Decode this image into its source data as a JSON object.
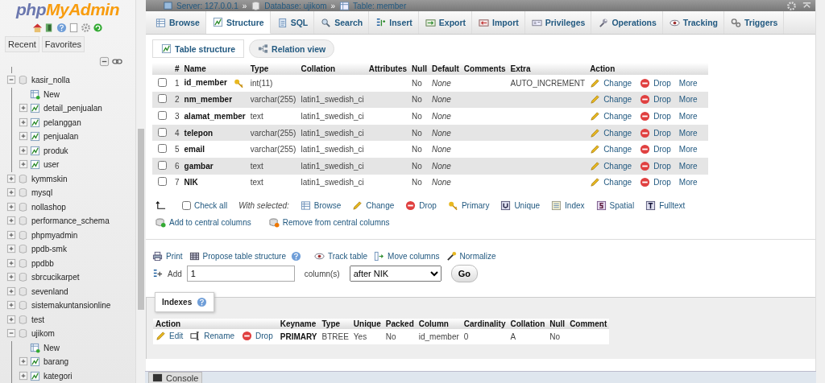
{
  "sidebar": {
    "logo_left": "php",
    "logo_right": "MyAdmin",
    "tabs": [
      {
        "label": "Recent"
      },
      {
        "label": "Favorites"
      }
    ],
    "tree": [
      {
        "kind": "db",
        "label": "kasir_nolla",
        "expanded": true,
        "children": [
          {
            "kind": "new",
            "label": "New"
          },
          {
            "kind": "table",
            "label": "detail_penjualan",
            "expanded": false
          },
          {
            "kind": "table",
            "label": "pelanggan",
            "expanded": false
          },
          {
            "kind": "table",
            "label": "penjualan",
            "expanded": false
          },
          {
            "kind": "table",
            "label": "produk",
            "expanded": false
          },
          {
            "kind": "table",
            "label": "user",
            "expanded": false
          }
        ]
      },
      {
        "kind": "db",
        "label": "kymmskin",
        "expanded": false
      },
      {
        "kind": "db",
        "label": "mysql",
        "expanded": false
      },
      {
        "kind": "db",
        "label": "nollashop",
        "expanded": false
      },
      {
        "kind": "db",
        "label": "performance_schema",
        "expanded": false
      },
      {
        "kind": "db",
        "label": "phpmyadmin",
        "expanded": false
      },
      {
        "kind": "db",
        "label": "ppdb-smk",
        "expanded": false
      },
      {
        "kind": "db",
        "label": "ppdbb",
        "expanded": false
      },
      {
        "kind": "db",
        "label": "sbrcucikarpet",
        "expanded": false
      },
      {
        "kind": "db",
        "label": "sevenland",
        "expanded": false
      },
      {
        "kind": "db",
        "label": "sistemakuntansionline",
        "expanded": false
      },
      {
        "kind": "db",
        "label": "test",
        "expanded": false
      },
      {
        "kind": "db",
        "label": "ujikom",
        "expanded": true,
        "children": [
          {
            "kind": "new",
            "label": "New"
          },
          {
            "kind": "table",
            "label": "barang",
            "expanded": false
          },
          {
            "kind": "table",
            "label": "kategori",
            "expanded": false
          }
        ]
      }
    ]
  },
  "breadcrumb": {
    "separator": "»",
    "items": [
      "Server: 127.0.0.1",
      "Database: ujikom",
      "Table: member"
    ]
  },
  "tabs": [
    {
      "label": "Browse",
      "selected": false
    },
    {
      "label": "Structure",
      "selected": true
    },
    {
      "label": "SQL",
      "selected": false
    },
    {
      "label": "Search",
      "selected": false
    },
    {
      "label": "Insert",
      "selected": false
    },
    {
      "label": "Export",
      "selected": false
    },
    {
      "label": "Import",
      "selected": false
    },
    {
      "label": "Privileges",
      "selected": false
    },
    {
      "label": "Operations",
      "selected": false
    },
    {
      "label": "Tracking",
      "selected": false
    },
    {
      "label": "Triggers",
      "selected": false
    }
  ],
  "subtabs": [
    {
      "label": "Table structure",
      "selected": true
    },
    {
      "label": "Relation view",
      "selected": false
    }
  ],
  "structure": {
    "columns": [
      "#",
      "Name",
      "Type",
      "Collation",
      "Attributes",
      "Null",
      "Default",
      "Comments",
      "Extra",
      "Action"
    ],
    "rows": [
      {
        "checked": false,
        "num": "1",
        "name": "id_member",
        "primary": true,
        "type": "int(11)",
        "collation": "",
        "null": "No",
        "default": "None",
        "extra": "AUTO_INCREMENT",
        "actions": [
          "Change",
          "Drop",
          "More"
        ]
      },
      {
        "checked": false,
        "num": "2",
        "name": "nm_member",
        "primary": false,
        "type": "varchar(255)",
        "collation": "latin1_swedish_ci",
        "null": "No",
        "default": "None",
        "extra": "",
        "actions": [
          "Change",
          "Drop",
          "More"
        ]
      },
      {
        "checked": false,
        "num": "3",
        "name": "alamat_member",
        "primary": false,
        "type": "text",
        "collation": "latin1_swedish_ci",
        "null": "No",
        "default": "None",
        "extra": "",
        "actions": [
          "Change",
          "Drop",
          "More"
        ]
      },
      {
        "checked": false,
        "num": "4",
        "name": "telepon",
        "primary": false,
        "type": "varchar(255)",
        "collation": "latin1_swedish_ci",
        "null": "No",
        "default": "None",
        "extra": "",
        "actions": [
          "Change",
          "Drop",
          "More"
        ]
      },
      {
        "checked": false,
        "num": "5",
        "name": "email",
        "primary": false,
        "type": "varchar(255)",
        "collation": "latin1_swedish_ci",
        "null": "No",
        "default": "None",
        "extra": "",
        "actions": [
          "Change",
          "Drop",
          "More"
        ]
      },
      {
        "checked": false,
        "num": "6",
        "name": "gambar",
        "primary": false,
        "type": "text",
        "collation": "latin1_swedish_ci",
        "null": "No",
        "default": "None",
        "extra": "",
        "actions": [
          "Change",
          "Drop",
          "More"
        ]
      },
      {
        "checked": false,
        "num": "7",
        "name": "NIK",
        "primary": false,
        "type": "text",
        "collation": "latin1_swedish_ci",
        "null": "No",
        "default": "None",
        "extra": "",
        "actions": [
          "Change",
          "Drop",
          "More"
        ]
      }
    ],
    "check_all": {
      "label": "Check all",
      "checked": false
    },
    "with_selected": "With selected:",
    "bulk_actions": [
      "Browse",
      "Change",
      "Drop",
      "Primary",
      "Unique",
      "Index",
      "Spatial",
      "Fulltext"
    ],
    "central_actions": [
      "Add to central columns",
      "Remove from central columns"
    ]
  },
  "operations": [
    "Print",
    "Propose table structure",
    "Track table",
    "Move columns",
    "Normalize"
  ],
  "add_columns": {
    "label": "Add",
    "value": "1",
    "unit": "column(s)",
    "position": "after NIK",
    "button": "Go"
  },
  "indexes": {
    "title": "Indexes",
    "columns": [
      "Action",
      "Keyname",
      "Type",
      "Unique",
      "Packed",
      "Column",
      "Cardinality",
      "Collation",
      "Null",
      "Comment"
    ],
    "rows": [
      {
        "actions": [
          "Edit",
          "Rename",
          "Drop"
        ],
        "keyname": "PRIMARY",
        "type": "BTREE",
        "unique": "Yes",
        "packed": "No",
        "column": "id_member",
        "cardinality": "0",
        "collation": "A",
        "null": "No",
        "comment": ""
      }
    ]
  },
  "console": {
    "label": "Console"
  }
}
